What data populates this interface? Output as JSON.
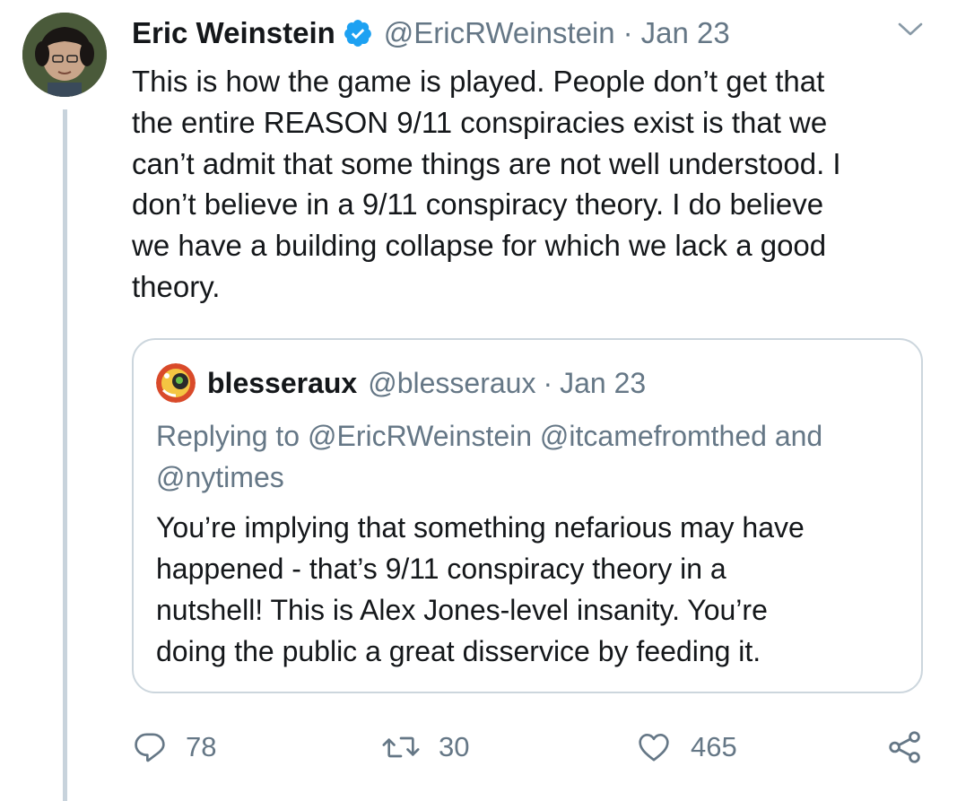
{
  "tweet": {
    "author": {
      "display_name": "Eric Weinstein",
      "handle": "@EricRWeinstein",
      "verified": true
    },
    "separator": "·",
    "date": "Jan 23",
    "text": "This is how the game is played. People don’t get that\nthe entire REASON 9/11 conspiracies exist is that we\ncan’t admit that some things are not well understood. I\ndon’t believe in a 9/11 conspiracy theory. I do believe\nwe have a building collapse for which we lack a good\ntheory."
  },
  "quoted_tweet": {
    "author": {
      "display_name": "blesseraux",
      "handle": "@blesseraux"
    },
    "separator": "·",
    "date": "Jan 23",
    "replying_prefix": "Replying to",
    "mention_1": "@EricRWeinstein",
    "mention_2": "@itcamefromthed",
    "replying_and": "and",
    "mention_3": "@nytimes",
    "text": "You’re implying that something nefarious may have\nhappened - that’s 9/11 conspiracy theory in a\nnutshell! This is Alex Jones-level insanity. You’re\ndoing the public a great disservice by feeding it."
  },
  "actions": {
    "replies": "78",
    "retweets": "30",
    "likes": "465"
  },
  "icons": {
    "verified": "verified-badge-icon",
    "caret": "chevron-down-icon",
    "reply": "reply-bubble-icon",
    "retweet": "retweet-icon",
    "like": "heart-icon",
    "share": "share-icon"
  },
  "colors": {
    "verified_blue": "#1da1f2",
    "secondary_text": "#657786",
    "primary_text": "#14171a",
    "border": "#ccd6dd"
  }
}
